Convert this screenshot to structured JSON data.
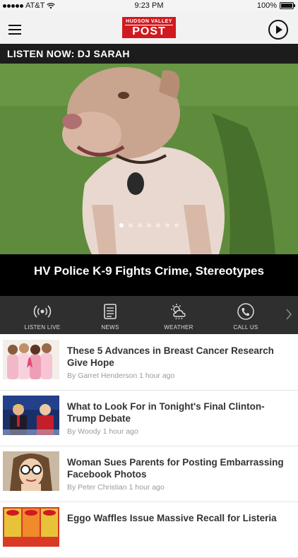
{
  "status": {
    "carrier": "AT&T",
    "time": "9:23 PM",
    "battery": "100%",
    "battery_level": 1.0
  },
  "header": {
    "logo_top": "HUDSON VALLEY",
    "logo_main": "POST"
  },
  "hero": {
    "listen_now": "LISTEN NOW: DJ SARAH",
    "title": "HV Police K-9 Fights Crime, Stereotypes",
    "dots": 7,
    "active_dot": 0
  },
  "quick_actions": [
    {
      "label": "LISTEN LIVE",
      "icon": "broadcast-icon"
    },
    {
      "label": "NEWS",
      "icon": "news-icon"
    },
    {
      "label": "WEATHER",
      "icon": "weather-icon"
    },
    {
      "label": "CALL US",
      "icon": "phone-icon"
    }
  ],
  "stories": [
    {
      "title": "These 5 Advances in Breast Cancer Research Give Hope",
      "meta": "By Garret Henderson 1 hour ago"
    },
    {
      "title": "What to Look For in Tonight's Final Clinton-Trump Debate",
      "meta": "By Woody 1 hour ago"
    },
    {
      "title": "Woman Sues Parents for Posting Embarrassing Facebook Photos",
      "meta": "By Peter Christian 1 hour ago"
    },
    {
      "title": "Eggo Waffles Issue Massive Recall for Listeria",
      "meta": ""
    }
  ],
  "colors": {
    "brand_red": "#d01a1f",
    "quickbar_bg": "#2f2f2f"
  }
}
